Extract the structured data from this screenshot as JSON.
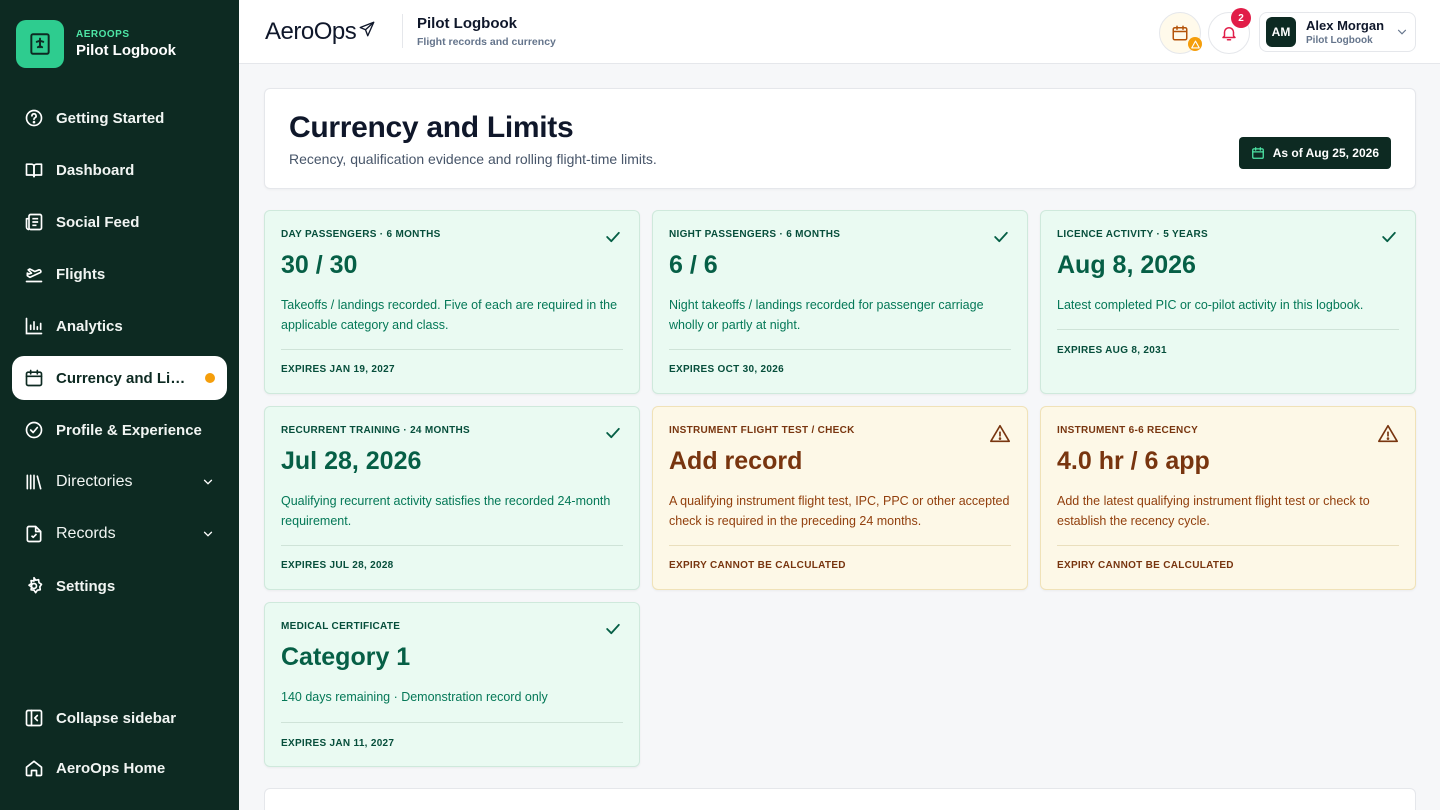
{
  "brand": {
    "small": "AEROOPS",
    "big": "Pilot Logbook",
    "icon": "logbook-logo-icon"
  },
  "nav": {
    "items": [
      {
        "label": "Getting Started",
        "icon": "help-circle-icon"
      },
      {
        "label": "Dashboard",
        "icon": "book-open-icon"
      },
      {
        "label": "Social Feed",
        "icon": "newspaper-icon"
      },
      {
        "label": "Flights",
        "icon": "plane-takeoff-icon"
      },
      {
        "label": "Analytics",
        "icon": "bar-chart-icon"
      },
      {
        "label": "Currency and Limits",
        "icon": "calendar-icon",
        "active": true
      },
      {
        "label": "Profile & Experience",
        "icon": "check-circle-icon"
      },
      {
        "label": "Directories",
        "icon": "library-icon"
      },
      {
        "label": "Records",
        "icon": "file-icon"
      },
      {
        "label": "Settings",
        "icon": "gear-icon"
      }
    ],
    "bottom": [
      {
        "label": "Collapse sidebar",
        "icon": "collapse-sidebar-icon"
      },
      {
        "label": "AeroOps Home",
        "icon": "home-icon"
      }
    ]
  },
  "topbar": {
    "logo": "AeroOps",
    "title": "Pilot Logbook",
    "subtitle": "Flight records and currency",
    "notification_count": "2",
    "user": {
      "initials": "AM",
      "name": "Alex Morgan",
      "role": "Pilot Logbook"
    }
  },
  "header": {
    "title": "Currency and Limits",
    "subtitle": "Recency, qualification evidence and rolling flight-time limits.",
    "as_of": "As of Aug 25, 2026"
  },
  "cards": [
    {
      "label": "DAY PASSENGERS · 6 MONTHS",
      "value": "30 / 30",
      "desc": "Takeoffs / landings recorded. Five of each are required in the applicable category and class.",
      "foot": "EXPIRES JAN 19, 2027",
      "status": "ok"
    },
    {
      "label": "NIGHT PASSENGERS · 6 MONTHS",
      "value": "6 / 6",
      "desc": "Night takeoffs / landings recorded for passenger carriage wholly or partly at night.",
      "foot": "EXPIRES OCT 30, 2026",
      "status": "ok"
    },
    {
      "label": "LICENCE ACTIVITY · 5 YEARS",
      "value": "Aug 8, 2026",
      "desc": "Latest completed PIC or co-pilot activity in this logbook.",
      "foot": "EXPIRES AUG 8, 2031",
      "status": "ok"
    },
    {
      "label": "RECURRENT TRAINING · 24 MONTHS",
      "value": "Jul 28, 2026",
      "desc": "Qualifying recurrent activity satisfies the recorded 24-month requirement.",
      "foot": "EXPIRES JUL 28, 2028",
      "status": "ok"
    },
    {
      "label": "INSTRUMENT FLIGHT TEST / CHECK",
      "value": "Add record",
      "desc": "A qualifying instrument flight test, IPC, PPC or other accepted check is required in the preceding 24 months.",
      "foot": "EXPIRY CANNOT BE CALCULATED",
      "status": "warn"
    },
    {
      "label": "INSTRUMENT 6-6 RECENCY",
      "value": "4.0 hr / 6 app",
      "desc": "Add the latest qualifying instrument flight test or check to establish the recency cycle.",
      "foot": "EXPIRY CANNOT BE CALCULATED",
      "status": "warn"
    },
    {
      "label": "MEDICAL CERTIFICATE",
      "value": "Category 1",
      "desc": "140 days remaining · Demonstration record only",
      "foot": "EXPIRES JAN 11, 2027",
      "status": "ok"
    }
  ]
}
